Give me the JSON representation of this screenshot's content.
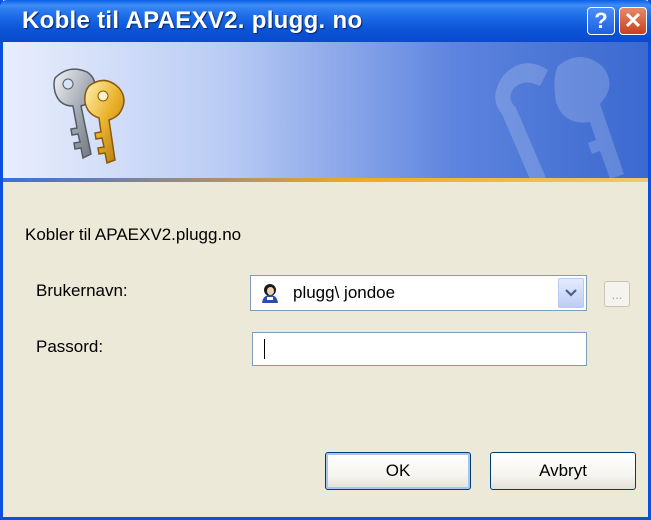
{
  "window": {
    "title": "Koble til APAEXV2. plugg. no"
  },
  "titlebar": {
    "help_label": "?",
    "close_label": "✕",
    "help_icon": "help-icon",
    "close_icon": "close-icon"
  },
  "banner": {
    "icon": "keys-icon"
  },
  "dialog": {
    "connect_text": "Kobler til APAEXV2.plugg.no",
    "username_label": "Brukernavn:",
    "username_value": "plugg\\ jondoe",
    "password_label": "Passord:",
    "password_value": "",
    "browse_label": "...",
    "ok_label": "OK",
    "cancel_label": "Avbryt"
  },
  "colors": {
    "title_blue": "#0a4fdd",
    "dialog_bg": "#ece9d8",
    "accent_orange": "#f5a623"
  }
}
